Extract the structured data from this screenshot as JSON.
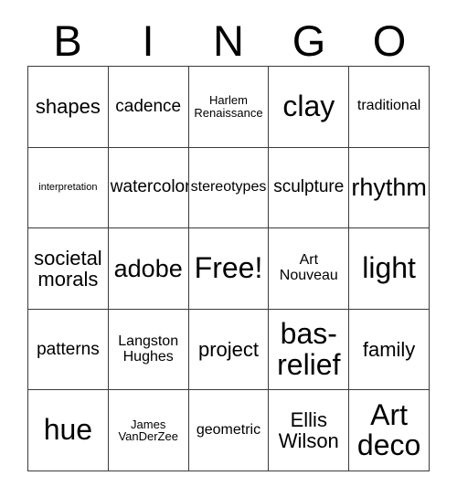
{
  "card": {
    "header_letters": [
      "B",
      "I",
      "N",
      "G",
      "O"
    ],
    "rows": [
      [
        {
          "label": "shapes",
          "size": "fs-md"
        },
        {
          "label": "cadence",
          "size": "fs-sm"
        },
        {
          "label": "Harlem Renaissance",
          "size": "fs-xxs"
        },
        {
          "label": "clay",
          "size": "fs-xl"
        },
        {
          "label": "traditional",
          "size": "fs-xs"
        }
      ],
      [
        {
          "label": "interpretation",
          "size": "fs-tiny"
        },
        {
          "label": "watercolor",
          "size": "fs-sm"
        },
        {
          "label": "stereotypes",
          "size": "fs-xs"
        },
        {
          "label": "sculpture",
          "size": "fs-sm"
        },
        {
          "label": "rhythm",
          "size": "fs-lg"
        }
      ],
      [
        {
          "label": "societal morals",
          "size": "fs-md"
        },
        {
          "label": "adobe",
          "size": "fs-lg"
        },
        {
          "label": "Free!",
          "size": "fs-xl"
        },
        {
          "label": "Art Nouveau",
          "size": "fs-xs"
        },
        {
          "label": "light",
          "size": "fs-xl"
        }
      ],
      [
        {
          "label": "patterns",
          "size": "fs-sm"
        },
        {
          "label": "Langston Hughes",
          "size": "fs-xs"
        },
        {
          "label": "project",
          "size": "fs-md"
        },
        {
          "label": "bas-relief",
          "size": "fs-xl"
        },
        {
          "label": "family",
          "size": "fs-md"
        }
      ],
      [
        {
          "label": "hue",
          "size": "fs-xl"
        },
        {
          "label": "James VanDerZee",
          "size": "fs-xxs"
        },
        {
          "label": "geometric",
          "size": "fs-xs"
        },
        {
          "label": "Ellis Wilson",
          "size": "fs-md"
        },
        {
          "label": "Art deco",
          "size": "fs-xl"
        }
      ]
    ]
  }
}
